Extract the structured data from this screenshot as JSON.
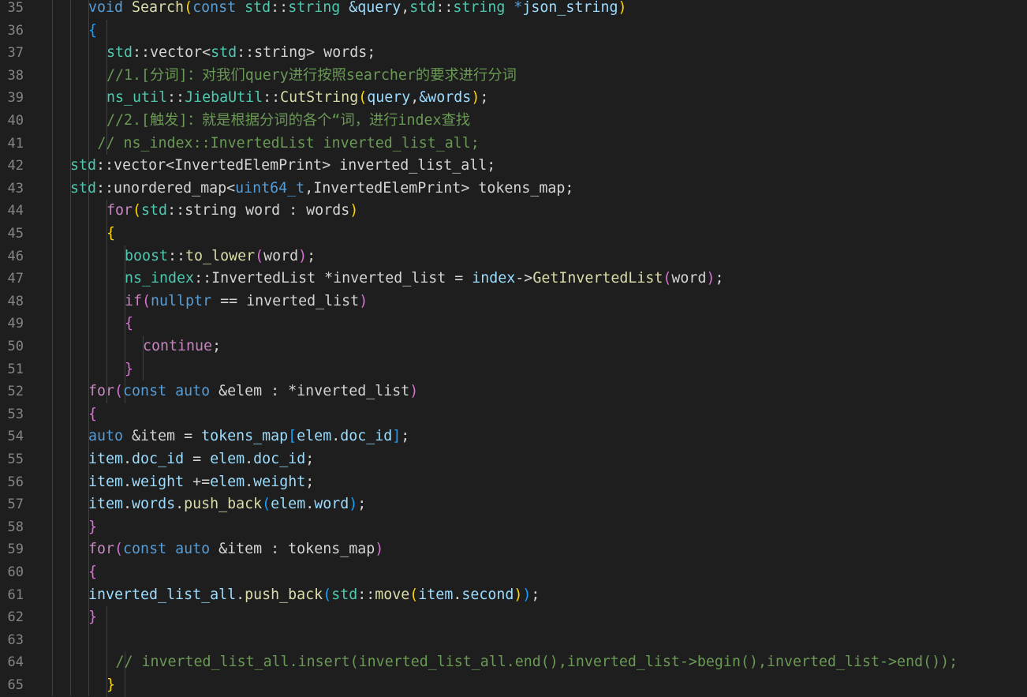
{
  "editor": {
    "colors": {
      "background": "#1e1e1e",
      "line_number": "#858585",
      "keyword": "#569cd6",
      "control": "#c586c0",
      "type": "#4ec9b0",
      "function": "#dcdcaa",
      "variable": "#9cdcfe",
      "comment": "#6a9955",
      "text": "#d4d4d4",
      "bracket_1": "#ffd700",
      "bracket_2": "#da70d6",
      "bracket_3": "#179fff"
    },
    "lines": [
      {
        "num": "35",
        "indent": 3,
        "tokens": [
          [
            "kw",
            "void "
          ],
          [
            "fn",
            "Search"
          ],
          [
            "b1",
            "("
          ],
          [
            "kw",
            "const "
          ],
          [
            "type",
            "std"
          ],
          [
            "txt",
            "::"
          ],
          [
            "type",
            "string "
          ],
          [
            "var",
            "&query"
          ],
          [
            "txt",
            ","
          ],
          [
            "type",
            "std"
          ],
          [
            "txt",
            "::"
          ],
          [
            "type",
            "string "
          ],
          [
            "kw",
            "*"
          ],
          [
            "var",
            "json_string"
          ],
          [
            "b1",
            ")"
          ]
        ]
      },
      {
        "num": "36",
        "indent": 3,
        "tokens": [
          [
            "b3",
            "{"
          ]
        ]
      },
      {
        "num": "37",
        "indent": 4,
        "tokens": [
          [
            "type",
            "std"
          ],
          [
            "txt",
            "::vector<"
          ],
          [
            "type",
            "std"
          ],
          [
            "txt",
            "::string> words;"
          ]
        ]
      },
      {
        "num": "38",
        "indent": 4,
        "tokens": [
          [
            "cm",
            "//1.[分词]：对我们query进行按照searcher的要求进行分词"
          ]
        ]
      },
      {
        "num": "39",
        "indent": 4,
        "tokens": [
          [
            "type",
            "ns_util"
          ],
          [
            "txt",
            "::"
          ],
          [
            "type",
            "JiebaUtil"
          ],
          [
            "txt",
            "::"
          ],
          [
            "fn",
            "CutString"
          ],
          [
            "b1",
            "("
          ],
          [
            "var",
            "query"
          ],
          [
            "txt",
            ","
          ],
          [
            "var",
            "&words"
          ],
          [
            "b1",
            ")"
          ],
          [
            "txt",
            ";"
          ]
        ]
      },
      {
        "num": "40",
        "indent": 4,
        "tokens": [
          [
            "cm",
            "//2.[触发]：就是根据分词的各个“词，进行index查找"
          ]
        ]
      },
      {
        "num": "41",
        "indent": 3.5,
        "tokens": [
          [
            "cm",
            "// ns_index::InvertedList inverted_list_all;"
          ]
        ]
      },
      {
        "num": "42",
        "indent": 2,
        "tokens": [
          [
            "type",
            "std"
          ],
          [
            "txt",
            "::vector<InvertedElemPrint> inverted_list_all;"
          ]
        ]
      },
      {
        "num": "43",
        "indent": 2,
        "tokens": [
          [
            "type",
            "std"
          ],
          [
            "txt",
            "::unordered_map<"
          ],
          [
            "kw",
            "uint64_t"
          ],
          [
            "txt",
            ",InvertedElemPrint> tokens_map;"
          ]
        ]
      },
      {
        "num": "44",
        "indent": 4,
        "tokens": [
          [
            "ctl",
            "for"
          ],
          [
            "b1",
            "("
          ],
          [
            "type",
            "std"
          ],
          [
            "txt",
            "::string word : words"
          ],
          [
            "b1",
            ")"
          ]
        ]
      },
      {
        "num": "45",
        "indent": 4,
        "tokens": [
          [
            "b1",
            "{"
          ]
        ]
      },
      {
        "num": "46",
        "indent": 5,
        "tokens": [
          [
            "type",
            "boost"
          ],
          [
            "txt",
            "::"
          ],
          [
            "fn",
            "to_lower"
          ],
          [
            "b2",
            "("
          ],
          [
            "txt",
            "word"
          ],
          [
            "b2",
            ")"
          ],
          [
            "txt",
            ";"
          ]
        ]
      },
      {
        "num": "47",
        "indent": 5,
        "tokens": [
          [
            "type",
            "ns_index"
          ],
          [
            "txt",
            "::InvertedList *inverted_list = "
          ],
          [
            "var",
            "index"
          ],
          [
            "txt",
            "->"
          ],
          [
            "fn",
            "GetInvertedList"
          ],
          [
            "b2",
            "("
          ],
          [
            "txt",
            "word"
          ],
          [
            "b2",
            ")"
          ],
          [
            "txt",
            ";"
          ]
        ]
      },
      {
        "num": "48",
        "indent": 5,
        "tokens": [
          [
            "ctl",
            "if"
          ],
          [
            "b2",
            "("
          ],
          [
            "kw",
            "nullptr"
          ],
          [
            "txt",
            " == inverted_list"
          ],
          [
            "b2",
            ")"
          ]
        ]
      },
      {
        "num": "49",
        "indent": 5,
        "tokens": [
          [
            "b2",
            "{"
          ]
        ]
      },
      {
        "num": "50",
        "indent": 6,
        "tokens": [
          [
            "ctl",
            "continue"
          ],
          [
            "txt",
            ";"
          ]
        ]
      },
      {
        "num": "51",
        "indent": 5,
        "tokens": [
          [
            "b2",
            "}"
          ]
        ]
      },
      {
        "num": "52",
        "indent": 3,
        "tokens": [
          [
            "ctl",
            "for"
          ],
          [
            "b2",
            "("
          ],
          [
            "kw",
            "const "
          ],
          [
            "kw",
            "auto "
          ],
          [
            "txt",
            "&elem : *inverted_list"
          ],
          [
            "b2",
            ")"
          ]
        ]
      },
      {
        "num": "53",
        "indent": 3,
        "tokens": [
          [
            "b2",
            "{"
          ]
        ]
      },
      {
        "num": "54",
        "indent": 3,
        "tokens": [
          [
            "kw",
            "auto "
          ],
          [
            "txt",
            "&item = "
          ],
          [
            "var",
            "tokens_map"
          ],
          [
            "b3",
            "["
          ],
          [
            "var",
            "elem"
          ],
          [
            "txt",
            "."
          ],
          [
            "var",
            "doc_id"
          ],
          [
            "b3",
            "]"
          ],
          [
            "txt",
            ";"
          ]
        ]
      },
      {
        "num": "55",
        "indent": 3,
        "tokens": [
          [
            "var",
            "item"
          ],
          [
            "txt",
            "."
          ],
          [
            "var",
            "doc_id"
          ],
          [
            "txt",
            " = "
          ],
          [
            "var",
            "elem"
          ],
          [
            "txt",
            "."
          ],
          [
            "var",
            "doc_id"
          ],
          [
            "txt",
            ";"
          ]
        ]
      },
      {
        "num": "56",
        "indent": 3,
        "tokens": [
          [
            "var",
            "item"
          ],
          [
            "txt",
            "."
          ],
          [
            "var",
            "weight"
          ],
          [
            "txt",
            " +="
          ],
          [
            "var",
            "elem"
          ],
          [
            "txt",
            "."
          ],
          [
            "var",
            "weight"
          ],
          [
            "txt",
            ";"
          ]
        ]
      },
      {
        "num": "57",
        "indent": 3,
        "tokens": [
          [
            "var",
            "item"
          ],
          [
            "txt",
            "."
          ],
          [
            "var",
            "words"
          ],
          [
            "txt",
            "."
          ],
          [
            "fn",
            "push_back"
          ],
          [
            "b3",
            "("
          ],
          [
            "var",
            "elem"
          ],
          [
            "txt",
            "."
          ],
          [
            "var",
            "word"
          ],
          [
            "b3",
            ")"
          ],
          [
            "txt",
            ";"
          ]
        ]
      },
      {
        "num": "58",
        "indent": 3,
        "tokens": [
          [
            "b2",
            "}"
          ]
        ]
      },
      {
        "num": "59",
        "indent": 3,
        "tokens": [
          [
            "ctl",
            "for"
          ],
          [
            "b2",
            "("
          ],
          [
            "kw",
            "const "
          ],
          [
            "kw",
            "auto "
          ],
          [
            "txt",
            "&item : tokens_map"
          ],
          [
            "b2",
            ")"
          ]
        ]
      },
      {
        "num": "60",
        "indent": 3,
        "tokens": [
          [
            "b2",
            "{"
          ]
        ]
      },
      {
        "num": "61",
        "indent": 3,
        "tokens": [
          [
            "var",
            "inverted_list_all"
          ],
          [
            "txt",
            "."
          ],
          [
            "fn",
            "push_back"
          ],
          [
            "b3",
            "("
          ],
          [
            "type",
            "std"
          ],
          [
            "txt",
            "::"
          ],
          [
            "fn",
            "move"
          ],
          [
            "b1",
            "("
          ],
          [
            "var",
            "item"
          ],
          [
            "txt",
            "."
          ],
          [
            "var",
            "second"
          ],
          [
            "b1",
            ")"
          ],
          [
            "b3",
            ")"
          ],
          [
            "txt",
            ";"
          ]
        ]
      },
      {
        "num": "62",
        "indent": 3,
        "tokens": [
          [
            "b2",
            "}"
          ]
        ]
      },
      {
        "num": "63",
        "indent": 3,
        "tokens": []
      },
      {
        "num": "64",
        "indent": 4.5,
        "tokens": [
          [
            "cm",
            "// inverted_list_all.insert(inverted_list_all.end(),inverted_list->begin(),inverted_list->end());"
          ]
        ]
      },
      {
        "num": "65",
        "indent": 4,
        "tokens": [
          [
            "b1",
            "}"
          ]
        ]
      }
    ]
  }
}
